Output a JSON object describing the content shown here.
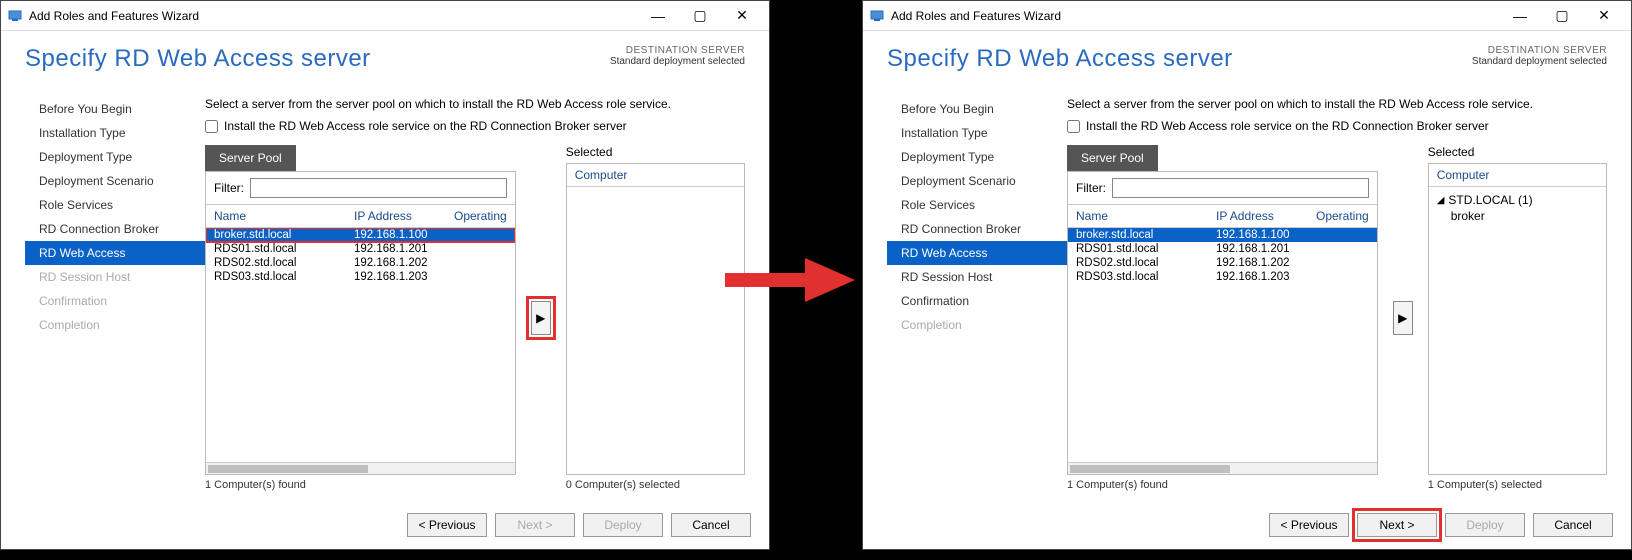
{
  "left": {
    "titlebar": "Add Roles and Features Wizard",
    "heading": "Specify RD Web Access server",
    "dest_label": "DESTINATION SERVER",
    "dest_value": "Standard deployment selected",
    "nav": [
      {
        "label": "Before You Begin",
        "state": "normal"
      },
      {
        "label": "Installation Type",
        "state": "normal"
      },
      {
        "label": "Deployment Type",
        "state": "normal"
      },
      {
        "label": "Deployment Scenario",
        "state": "normal"
      },
      {
        "label": "Role Services",
        "state": "normal"
      },
      {
        "label": "RD Connection Broker",
        "state": "normal"
      },
      {
        "label": "RD Web Access",
        "state": "active"
      },
      {
        "label": "RD Session Host",
        "state": "disabled"
      },
      {
        "label": "Confirmation",
        "state": "disabled"
      },
      {
        "label": "Completion",
        "state": "disabled"
      }
    ],
    "instruction": "Select a server from the server pool on which to install the RD Web Access role service.",
    "checkbox_label": "Install the RD Web Access role service on the RD Connection Broker server",
    "pool_tab": "Server Pool",
    "filter_label": "Filter:",
    "filter_value": "",
    "columns": {
      "c1": "Name",
      "c2": "IP Address",
      "c3": "Operating"
    },
    "servers": [
      {
        "name": "broker.std.local",
        "ip": "192.168.1.100",
        "selected": true,
        "hl": true
      },
      {
        "name": "RDS01.std.local",
        "ip": "192.168.1.201",
        "selected": false
      },
      {
        "name": "RDS02.std.local",
        "ip": "192.168.1.202",
        "selected": false
      },
      {
        "name": "RDS03.std.local",
        "ip": "192.168.1.203",
        "selected": false
      }
    ],
    "found_note": "1 Computer(s) found",
    "selected_header": "Selected",
    "selected_col": "Computer",
    "selected_items": [],
    "selected_note": "0 Computer(s) selected",
    "add_button_hl": true,
    "buttons": {
      "prev": "< Previous",
      "prev_disabled": false,
      "next": "Next >",
      "next_disabled": true,
      "next_hl": false,
      "deploy": "Deploy",
      "deploy_disabled": true,
      "cancel": "Cancel"
    }
  },
  "right": {
    "titlebar": "Add Roles and Features Wizard",
    "heading": "Specify RD Web Access server",
    "dest_label": "DESTINATION SERVER",
    "dest_value": "Standard deployment selected",
    "nav": [
      {
        "label": "Before You Begin",
        "state": "normal"
      },
      {
        "label": "Installation Type",
        "state": "normal"
      },
      {
        "label": "Deployment Type",
        "state": "normal"
      },
      {
        "label": "Deployment Scenario",
        "state": "normal"
      },
      {
        "label": "Role Services",
        "state": "normal"
      },
      {
        "label": "RD Connection Broker",
        "state": "normal"
      },
      {
        "label": "RD Web Access",
        "state": "active"
      },
      {
        "label": "RD Session Host",
        "state": "normal"
      },
      {
        "label": "Confirmation",
        "state": "normal"
      },
      {
        "label": "Completion",
        "state": "disabled"
      }
    ],
    "instruction": "Select a server from the server pool on which to install the RD Web Access role service.",
    "checkbox_label": "Install the RD Web Access role service on the RD Connection Broker server",
    "pool_tab": "Server Pool",
    "filter_label": "Filter:",
    "filter_value": "",
    "columns": {
      "c1": "Name",
      "c2": "IP Address",
      "c3": "Operating"
    },
    "servers": [
      {
        "name": "broker.std.local",
        "ip": "192.168.1.100",
        "selected": true
      },
      {
        "name": "RDS01.std.local",
        "ip": "192.168.1.201",
        "selected": false
      },
      {
        "name": "RDS02.std.local",
        "ip": "192.168.1.202",
        "selected": false
      },
      {
        "name": "RDS03.std.local",
        "ip": "192.168.1.203",
        "selected": false
      }
    ],
    "found_note": "1 Computer(s) found",
    "selected_header": "Selected",
    "selected_col": "Computer",
    "selected_group": "STD.LOCAL (1)",
    "selected_items": [
      "broker"
    ],
    "selected_note": "1 Computer(s) selected",
    "add_button_hl": false,
    "buttons": {
      "prev": "< Previous",
      "prev_disabled": false,
      "next": "Next >",
      "next_disabled": false,
      "next_hl": true,
      "deploy": "Deploy",
      "deploy_disabled": true,
      "cancel": "Cancel"
    }
  }
}
